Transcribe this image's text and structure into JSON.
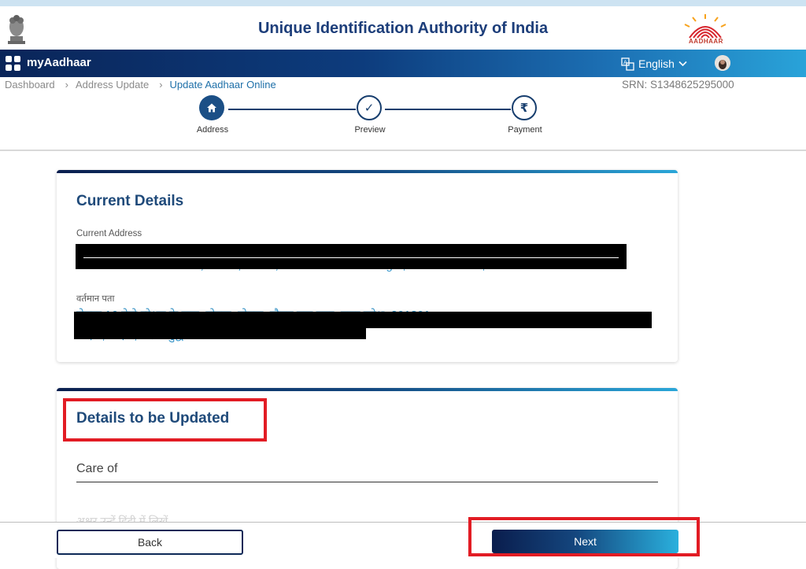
{
  "header": {
    "title": "Unique Identification Authority of India",
    "logo_text": "AADHAAR"
  },
  "navbar": {
    "brand": "myAadhaar",
    "language": "English",
    "accent_colors": [
      "#0a2559",
      "#29a3d9"
    ]
  },
  "breadcrumb": {
    "items": [
      "Dashboard",
      "Address Update",
      "Update Aadhaar Online"
    ],
    "separator": "›"
  },
  "srn": "SRN: S1348625295000",
  "stepper": {
    "steps": [
      {
        "label": "Address",
        "icon": "home-icon",
        "state": "active"
      },
      {
        "label": "Preview",
        "icon": "check-icon",
        "state": "pending"
      },
      {
        "label": "Payment",
        "icon": "rupee-icon",
        "state": "pending"
      }
    ],
    "icon_glyphs": {
      "check": "✓",
      "rupee": "₹"
    }
  },
  "current_details": {
    "title": "Current Details",
    "address_label": "Current Address",
    "address_value_partial": "Sector 16 Metro Station, Noida, Noida, Gautam Buddha Nagar, Uttar Pradesh, 201301",
    "hindi_label": "वर्तमान पता",
    "hindi_value_partial": "सेक्टर 16 मेट्रो स्टेशन के पास, नोएडा, नोएडा, गौतम बुद्ध नगर, उत्तर प्रदेश, 201301",
    "hindi_value_partial_2": "नोएडा, नोएडा, गौतम बुद्ध नगर"
  },
  "details_to_update": {
    "title": "Details to be Updated",
    "care_of_label": "Care of",
    "care_of_hindi_placeholder": "अक्षर उन्हें हिंदी में लिखें"
  },
  "footer": {
    "back_label": "Back",
    "next_label": "Next"
  },
  "highlight_color": "#e21c24"
}
